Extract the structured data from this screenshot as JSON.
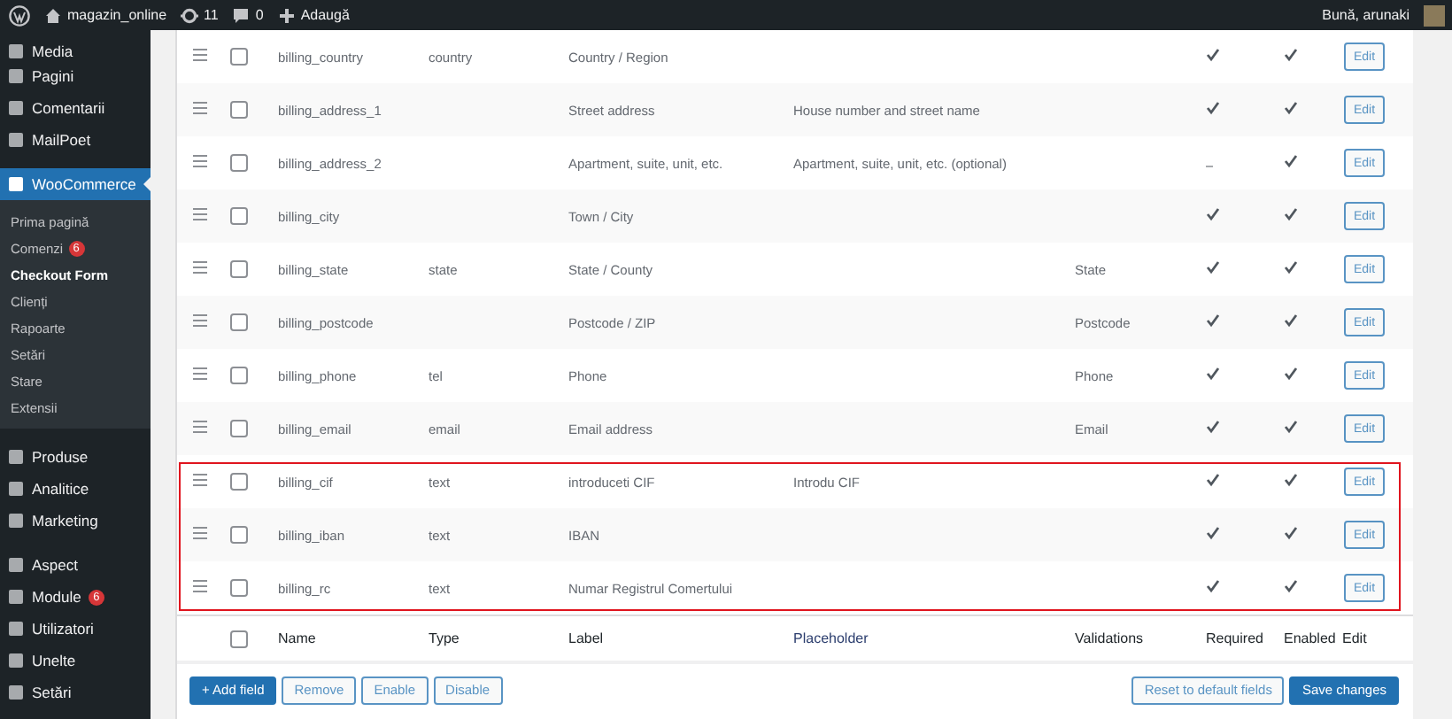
{
  "admin_bar": {
    "site_name": "magazin_online",
    "updates": "11",
    "comments": "0",
    "new_label": "Adaugă",
    "greeting": "Bună, arunaki"
  },
  "sidebar": {
    "groups": [
      {
        "items": [
          {
            "label": "Media",
            "selected": false
          },
          {
            "label": "Pagini",
            "selected": false
          },
          {
            "label": "Comentarii",
            "selected": false
          },
          {
            "label": "MailPoet",
            "selected": false
          }
        ]
      },
      {
        "items": [
          {
            "label": "WooCommerce",
            "selected": true,
            "children": [
              {
                "label": "Prima pagină",
                "selected": false
              },
              {
                "label": "Comenzi",
                "selected": false,
                "badge": "6"
              },
              {
                "label": "Checkout Form",
                "selected": true
              },
              {
                "label": "Clienți",
                "selected": false
              },
              {
                "label": "Rapoarte",
                "selected": false
              },
              {
                "label": "Setări",
                "selected": false
              },
              {
                "label": "Stare",
                "selected": false
              },
              {
                "label": "Extensii",
                "selected": false
              }
            ]
          }
        ]
      },
      {
        "items": [
          {
            "label": "Produse",
            "selected": false
          },
          {
            "label": "Analitice",
            "selected": false
          },
          {
            "label": "Marketing",
            "selected": false
          }
        ]
      },
      {
        "items": [
          {
            "label": "Aspect",
            "selected": false
          },
          {
            "label": "Module",
            "selected": false,
            "badge": "6"
          },
          {
            "label": "Utilizatori",
            "selected": false
          },
          {
            "label": "Unelte",
            "selected": false
          },
          {
            "label": "Setări",
            "selected": false
          }
        ]
      }
    ]
  },
  "table": {
    "columns": [
      "Name",
      "Type",
      "Label",
      "Placeholder",
      "Validations",
      "Required",
      "Enabled",
      "Edit"
    ],
    "rows": [
      {
        "name": "billing_country",
        "type": "country",
        "label": "Country / Region",
        "hint_text": "",
        "validations": "",
        "required": true,
        "enabled": true,
        "checked": false,
        "edit_label": "Edit"
      },
      {
        "name": "billing_address_1",
        "type": "",
        "label": "Street address",
        "hint_text": "House number and street name",
        "validations": "",
        "required": true,
        "enabled": true,
        "checked": false,
        "edit_label": "Edit"
      },
      {
        "name": "billing_address_2",
        "type": "",
        "label": "Apartment, suite, unit, etc.",
        "hint_text": "Apartment, suite, unit, etc. (optional)",
        "validations": "",
        "required": false,
        "enabled": true,
        "checked": false,
        "edit_label": "Edit"
      },
      {
        "name": "billing_city",
        "type": "",
        "label": "Town / City",
        "hint_text": "",
        "validations": "",
        "required": true,
        "enabled": true,
        "checked": false,
        "edit_label": "Edit"
      },
      {
        "name": "billing_state",
        "type": "state",
        "label": "State / County",
        "hint_text": "",
        "validations": "State",
        "required": true,
        "enabled": true,
        "checked": false,
        "edit_label": "Edit"
      },
      {
        "name": "billing_postcode",
        "type": "",
        "label": "Postcode / ZIP",
        "hint_text": "",
        "validations": "Postcode",
        "required": true,
        "enabled": true,
        "checked": false,
        "edit_label": "Edit"
      },
      {
        "name": "billing_phone",
        "type": "tel",
        "label": "Phone",
        "hint_text": "",
        "validations": "Phone",
        "required": true,
        "enabled": true,
        "checked": false,
        "edit_label": "Edit"
      },
      {
        "name": "billing_email",
        "type": "email",
        "label": "Email address",
        "hint_text": "",
        "validations": "Email",
        "required": true,
        "enabled": true,
        "checked": false,
        "edit_label": "Edit"
      }
    ],
    "highlighted_rows": [
      {
        "name": "billing_cif",
        "type": "text",
        "label": "introduceti CIF",
        "hint_text": "Introdu CIF",
        "validations": "",
        "required": true,
        "enabled": true,
        "checked": false,
        "edit_label": "Edit"
      },
      {
        "name": "billing_iban",
        "type": "text",
        "label": "IBAN",
        "hint_text": "",
        "validations": "",
        "required": true,
        "enabled": true,
        "checked": false,
        "edit_label": "Edit"
      },
      {
        "name": "billing_rc",
        "type": "text",
        "label": "Numar Registrul Comertului",
        "hint_text": "",
        "validations": "",
        "required": true,
        "enabled": true,
        "checked": false,
        "edit_label": "Edit"
      }
    ],
    "select_all_checked": false
  },
  "buttons_left": [
    "+ Add field",
    "Remove",
    "Enable",
    "Disable"
  ],
  "buttons_right": [
    "Reset to default fields",
    "Save changes"
  ]
}
